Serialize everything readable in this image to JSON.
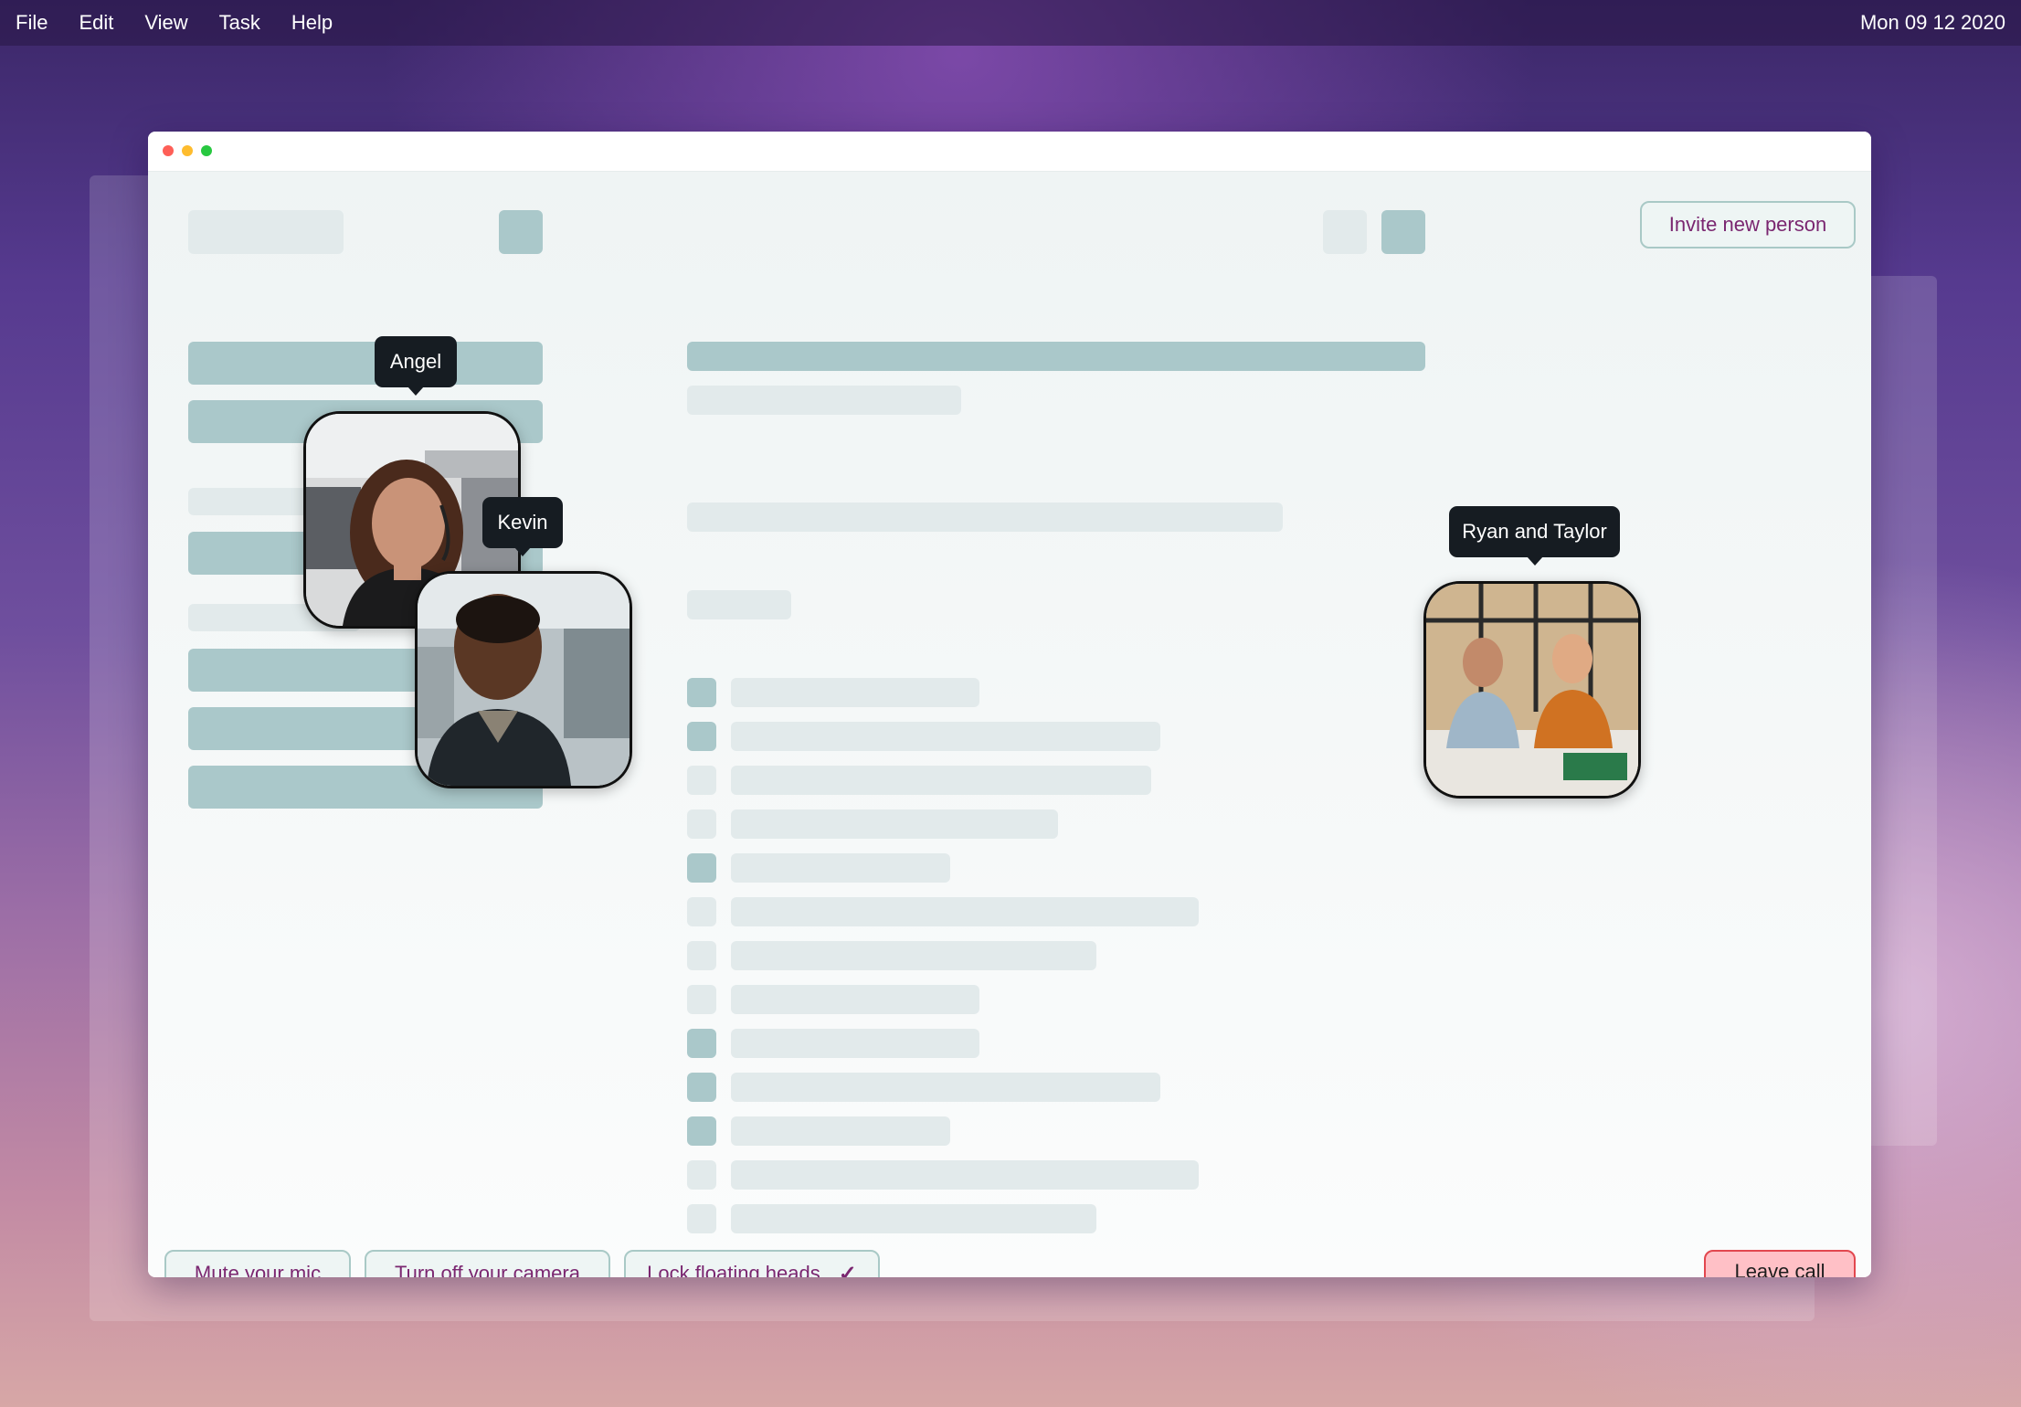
{
  "menubar": {
    "items": [
      "File",
      "Edit",
      "View",
      "Task",
      "Help"
    ],
    "clock": "Mon 09 12 2020"
  },
  "window": {
    "invite_label": "Invite new person"
  },
  "participants": {
    "angel": "Angel",
    "kevin": "Kevin",
    "ryan_taylor": "Ryan and Taylor"
  },
  "controls": {
    "mute_label": "Mute your mic",
    "camera_label": "Turn off your camera",
    "lock_label": "Lock floating heads",
    "lock_checked_icon": "checkmark-icon",
    "leave_label": "Leave call"
  },
  "colors": {
    "accent_text": "#7a2670",
    "leave_bg": "#ffc0c6",
    "leave_border": "#e2474f",
    "tag_bg": "#161c22",
    "skeleton_dark": "#aac8ca",
    "skeleton_light": "#e2eaeb"
  }
}
